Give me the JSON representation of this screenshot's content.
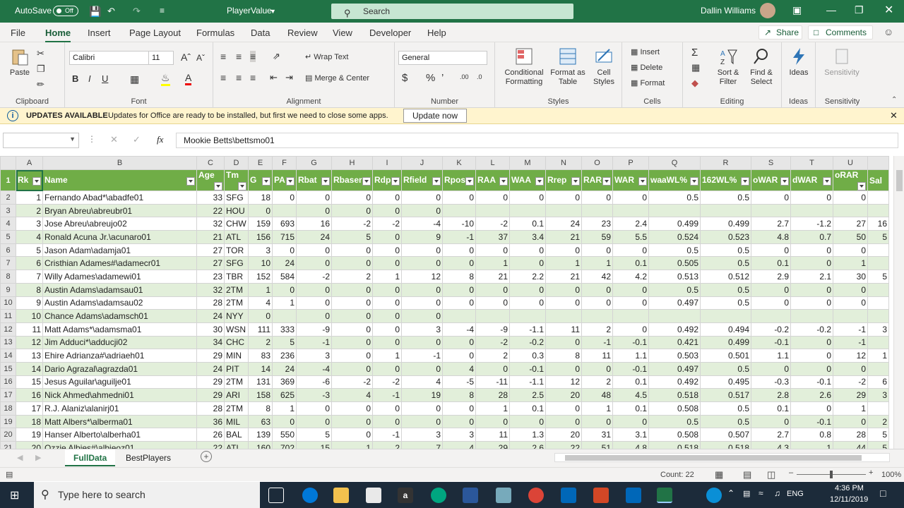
{
  "titlebar": {
    "autosave": "AutoSave",
    "toggle": "Off",
    "filename": "PlayerValue",
    "search": "Search",
    "user": "Dallin Williams"
  },
  "menu": {
    "tabs": [
      "File",
      "Home",
      "Insert",
      "Page Layout",
      "Formulas",
      "Data",
      "Review",
      "View",
      "Developer",
      "Help"
    ],
    "share": "Share",
    "comments": "Comments"
  },
  "ribbon": {
    "clipboard": {
      "label": "Clipboard",
      "paste": "Paste"
    },
    "font": {
      "label": "Font",
      "name": "Calibri",
      "size": "11",
      "bold": "B",
      "italic": "I",
      "underline": "U"
    },
    "alignment": {
      "label": "Alignment",
      "wrap": "Wrap Text",
      "merge": "Merge & Center"
    },
    "number": {
      "label": "Number",
      "format": "General"
    },
    "styles": {
      "label": "Styles",
      "conditional": "Conditional Formatting",
      "format_table": "Format as Table",
      "cell_styles": "Cell Styles"
    },
    "cells": {
      "label": "Cells",
      "insert": "Insert",
      "delete": "Delete",
      "format": "Format"
    },
    "editing": {
      "label": "Editing",
      "sort": "Sort & Filter",
      "find": "Find & Select"
    },
    "ideas": {
      "label": "Ideas",
      "btn": "Ideas"
    },
    "sensitivity": {
      "label": "Sensitivity",
      "btn": "Sensitivity"
    }
  },
  "update": {
    "title": "UPDATES AVAILABLE",
    "message": "Updates for Office are ready to be installed, but first we need to close some apps.",
    "button": "Update now"
  },
  "formula": {
    "content": "Mookie Betts\\bettsmo01",
    "fx": "fx"
  },
  "columns": [
    "A",
    "B",
    "C",
    "D",
    "E",
    "F",
    "G",
    "H",
    "I",
    "J",
    "K",
    "L",
    "M",
    "N",
    "O",
    "P",
    "Q",
    "R",
    "S",
    "T",
    "U",
    ""
  ],
  "headers": [
    "Rk",
    "Name",
    "Age",
    "Tm",
    "G",
    "PA",
    "Rbat",
    "Rbaser",
    "Rdp",
    "Rfield",
    "Rpos",
    "RAA",
    "WAA",
    "Rrep",
    "RAR",
    "WAR",
    "waaWL%",
    "162WL%",
    "oWAR",
    "dWAR",
    "oRAR",
    "Sal"
  ],
  "rows": [
    [
      "1",
      "Fernando Abad*\\abadfe01",
      "33",
      "SFG",
      "18",
      "0",
      "0",
      "0",
      "0",
      "0",
      "0",
      "0",
      "0",
      "0",
      "0",
      "0",
      "0.5",
      "0.5",
      "0",
      "0",
      "0",
      ""
    ],
    [
      "2",
      "Bryan Abreu\\abreubr01",
      "22",
      "HOU",
      "0",
      "",
      "0",
      "0",
      "0",
      "0",
      "",
      "",
      "",
      "",
      "",
      "",
      "",
      "",
      "",
      "",
      "",
      ""
    ],
    [
      "3",
      "Jose Abreu\\abreujo02",
      "32",
      "CHW",
      "159",
      "693",
      "16",
      "-2",
      "-2",
      "-4",
      "-10",
      "-2",
      "0.1",
      "24",
      "23",
      "2.4",
      "0.499",
      "0.499",
      "2.7",
      "-1.2",
      "27",
      "16"
    ],
    [
      "4",
      "Ronald Acuna Jr.\\acunaro01",
      "21",
      "ATL",
      "156",
      "715",
      "24",
      "5",
      "0",
      "9",
      "-1",
      "37",
      "3.4",
      "21",
      "59",
      "5.5",
      "0.524",
      "0.523",
      "4.8",
      "0.7",
      "50",
      "5"
    ],
    [
      "5",
      "Jason Adam\\adamja01",
      "27",
      "TOR",
      "3",
      "0",
      "0",
      "0",
      "0",
      "0",
      "0",
      "0",
      "0",
      "0",
      "0",
      "0",
      "0.5",
      "0.5",
      "0",
      "0",
      "0",
      ""
    ],
    [
      "6",
      "Cristhian Adames#\\adamecr01",
      "27",
      "SFG",
      "10",
      "24",
      "0",
      "0",
      "0",
      "0",
      "0",
      "1",
      "0",
      "1",
      "1",
      "0.1",
      "0.505",
      "0.5",
      "0.1",
      "0",
      "1",
      ""
    ],
    [
      "7",
      "Willy Adames\\adamewi01",
      "23",
      "TBR",
      "152",
      "584",
      "-2",
      "2",
      "1",
      "12",
      "8",
      "21",
      "2.2",
      "21",
      "42",
      "4.2",
      "0.513",
      "0.512",
      "2.9",
      "2.1",
      "30",
      "5"
    ],
    [
      "8",
      "Austin Adams\\adamsau01",
      "32",
      "2TM",
      "1",
      "0",
      "0",
      "0",
      "0",
      "0",
      "0",
      "0",
      "0",
      "0",
      "0",
      "0",
      "0.5",
      "0.5",
      "0",
      "0",
      "0",
      ""
    ],
    [
      "9",
      "Austin Adams\\adamsau02",
      "28",
      "2TM",
      "4",
      "1",
      "0",
      "0",
      "0",
      "0",
      "0",
      "0",
      "0",
      "0",
      "0",
      "0",
      "0.497",
      "0.5",
      "0",
      "0",
      "0",
      ""
    ],
    [
      "10",
      "Chance Adams\\adamsch01",
      "24",
      "NYY",
      "0",
      "",
      "0",
      "0",
      "0",
      "0",
      "",
      "",
      "",
      "",
      "",
      "",
      "",
      "",
      "",
      "",
      "",
      ""
    ],
    [
      "11",
      "Matt Adams*\\adamsma01",
      "30",
      "WSN",
      "111",
      "333",
      "-9",
      "0",
      "0",
      "3",
      "-4",
      "-9",
      "-1.1",
      "11",
      "2",
      "0",
      "0.492",
      "0.494",
      "-0.2",
      "-0.2",
      "-1",
      "3"
    ],
    [
      "12",
      "Jim Adduci*\\adducji02",
      "34",
      "CHC",
      "2",
      "5",
      "-1",
      "0",
      "0",
      "0",
      "0",
      "-2",
      "-0.2",
      "0",
      "-1",
      "-0.1",
      "0.421",
      "0.499",
      "-0.1",
      "0",
      "-1",
      ""
    ],
    [
      "13",
      "Ehire Adrianza#\\adriaeh01",
      "29",
      "MIN",
      "83",
      "236",
      "3",
      "0",
      "1",
      "-1",
      "0",
      "2",
      "0.3",
      "8",
      "11",
      "1.1",
      "0.503",
      "0.501",
      "1.1",
      "0",
      "12",
      "1"
    ],
    [
      "14",
      "Dario Agrazal\\agrazda01",
      "24",
      "PIT",
      "14",
      "24",
      "-4",
      "0",
      "0",
      "0",
      "4",
      "0",
      "-0.1",
      "0",
      "0",
      "-0.1",
      "0.497",
      "0.5",
      "0",
      "0",
      "0",
      ""
    ],
    [
      "15",
      "Jesus Aguilar\\aguilje01",
      "29",
      "2TM",
      "131",
      "369",
      "-6",
      "-2",
      "-2",
      "4",
      "-5",
      "-11",
      "-1.1",
      "12",
      "2",
      "0.1",
      "0.492",
      "0.495",
      "-0.3",
      "-0.1",
      "-2",
      "6"
    ],
    [
      "16",
      "Nick Ahmed\\ahmedni01",
      "29",
      "ARI",
      "158",
      "625",
      "-3",
      "4",
      "-1",
      "19",
      "8",
      "28",
      "2.5",
      "20",
      "48",
      "4.5",
      "0.518",
      "0.517",
      "2.8",
      "2.6",
      "29",
      "3"
    ],
    [
      "17",
      "R.J. Alaniz\\alanirj01",
      "28",
      "2TM",
      "8",
      "1",
      "0",
      "0",
      "0",
      "0",
      "0",
      "1",
      "0.1",
      "0",
      "1",
      "0.1",
      "0.508",
      "0.5",
      "0.1",
      "0",
      "1",
      ""
    ],
    [
      "18",
      "Matt Albers*\\alberma01",
      "36",
      "MIL",
      "63",
      "0",
      "0",
      "0",
      "0",
      "0",
      "0",
      "0",
      "0",
      "0",
      "0",
      "0",
      "0.5",
      "0.5",
      "0",
      "-0.1",
      "0",
      "2"
    ],
    [
      "19",
      "Hanser Alberto\\alberha01",
      "26",
      "BAL",
      "139",
      "550",
      "5",
      "0",
      "-1",
      "3",
      "3",
      "11",
      "1.3",
      "20",
      "31",
      "3.1",
      "0.508",
      "0.507",
      "2.7",
      "0.8",
      "28",
      "5"
    ],
    [
      "20",
      "Ozzie Albies#\\albieoz01",
      "22",
      "ATL",
      "160",
      "702",
      "15",
      "1",
      "2",
      "7",
      "4",
      "29",
      "2.6",
      "22",
      "51",
      "4.8",
      "0.518",
      "0.518",
      "4.3",
      "1",
      "44",
      "5"
    ]
  ],
  "sheets": {
    "tabs": [
      "FullData",
      "BestPlayers"
    ],
    "active": "FullData"
  },
  "status": {
    "count": "Count: 22",
    "zoom": "100%"
  },
  "taskbar": {
    "search": "Type here to search",
    "time": "4:36 PM",
    "date": "12/11/2019",
    "lang": "ENG"
  },
  "colors": {
    "excel_green": "#217346",
    "header_green": "#70ad47",
    "band": "#e2efda"
  }
}
